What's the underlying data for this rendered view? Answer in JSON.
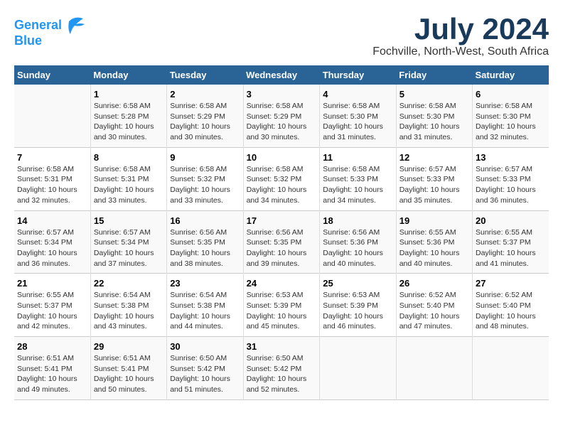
{
  "logo": {
    "line1": "General",
    "line2": "Blue"
  },
  "title": "July 2024",
  "location": "Fochville, North-West, South Africa",
  "days_header": [
    "Sunday",
    "Monday",
    "Tuesday",
    "Wednesday",
    "Thursday",
    "Friday",
    "Saturday"
  ],
  "rows": [
    [
      {
        "day": "",
        "content": ""
      },
      {
        "day": "1",
        "content": "Sunrise: 6:58 AM\nSunset: 5:28 PM\nDaylight: 10 hours\nand 30 minutes."
      },
      {
        "day": "2",
        "content": "Sunrise: 6:58 AM\nSunset: 5:29 PM\nDaylight: 10 hours\nand 30 minutes."
      },
      {
        "day": "3",
        "content": "Sunrise: 6:58 AM\nSunset: 5:29 PM\nDaylight: 10 hours\nand 30 minutes."
      },
      {
        "day": "4",
        "content": "Sunrise: 6:58 AM\nSunset: 5:30 PM\nDaylight: 10 hours\nand 31 minutes."
      },
      {
        "day": "5",
        "content": "Sunrise: 6:58 AM\nSunset: 5:30 PM\nDaylight: 10 hours\nand 31 minutes."
      },
      {
        "day": "6",
        "content": "Sunrise: 6:58 AM\nSunset: 5:30 PM\nDaylight: 10 hours\nand 32 minutes."
      }
    ],
    [
      {
        "day": "7",
        "content": "Sunrise: 6:58 AM\nSunset: 5:31 PM\nDaylight: 10 hours\nand 32 minutes."
      },
      {
        "day": "8",
        "content": "Sunrise: 6:58 AM\nSunset: 5:31 PM\nDaylight: 10 hours\nand 33 minutes."
      },
      {
        "day": "9",
        "content": "Sunrise: 6:58 AM\nSunset: 5:32 PM\nDaylight: 10 hours\nand 33 minutes."
      },
      {
        "day": "10",
        "content": "Sunrise: 6:58 AM\nSunset: 5:32 PM\nDaylight: 10 hours\nand 34 minutes."
      },
      {
        "day": "11",
        "content": "Sunrise: 6:58 AM\nSunset: 5:33 PM\nDaylight: 10 hours\nand 34 minutes."
      },
      {
        "day": "12",
        "content": "Sunrise: 6:57 AM\nSunset: 5:33 PM\nDaylight: 10 hours\nand 35 minutes."
      },
      {
        "day": "13",
        "content": "Sunrise: 6:57 AM\nSunset: 5:33 PM\nDaylight: 10 hours\nand 36 minutes."
      }
    ],
    [
      {
        "day": "14",
        "content": "Sunrise: 6:57 AM\nSunset: 5:34 PM\nDaylight: 10 hours\nand 36 minutes."
      },
      {
        "day": "15",
        "content": "Sunrise: 6:57 AM\nSunset: 5:34 PM\nDaylight: 10 hours\nand 37 minutes."
      },
      {
        "day": "16",
        "content": "Sunrise: 6:56 AM\nSunset: 5:35 PM\nDaylight: 10 hours\nand 38 minutes."
      },
      {
        "day": "17",
        "content": "Sunrise: 6:56 AM\nSunset: 5:35 PM\nDaylight: 10 hours\nand 39 minutes."
      },
      {
        "day": "18",
        "content": "Sunrise: 6:56 AM\nSunset: 5:36 PM\nDaylight: 10 hours\nand 40 minutes."
      },
      {
        "day": "19",
        "content": "Sunrise: 6:55 AM\nSunset: 5:36 PM\nDaylight: 10 hours\nand 40 minutes."
      },
      {
        "day": "20",
        "content": "Sunrise: 6:55 AM\nSunset: 5:37 PM\nDaylight: 10 hours\nand 41 minutes."
      }
    ],
    [
      {
        "day": "21",
        "content": "Sunrise: 6:55 AM\nSunset: 5:37 PM\nDaylight: 10 hours\nand 42 minutes."
      },
      {
        "day": "22",
        "content": "Sunrise: 6:54 AM\nSunset: 5:38 PM\nDaylight: 10 hours\nand 43 minutes."
      },
      {
        "day": "23",
        "content": "Sunrise: 6:54 AM\nSunset: 5:38 PM\nDaylight: 10 hours\nand 44 minutes."
      },
      {
        "day": "24",
        "content": "Sunrise: 6:53 AM\nSunset: 5:39 PM\nDaylight: 10 hours\nand 45 minutes."
      },
      {
        "day": "25",
        "content": "Sunrise: 6:53 AM\nSunset: 5:39 PM\nDaylight: 10 hours\nand 46 minutes."
      },
      {
        "day": "26",
        "content": "Sunrise: 6:52 AM\nSunset: 5:40 PM\nDaylight: 10 hours\nand 47 minutes."
      },
      {
        "day": "27",
        "content": "Sunrise: 6:52 AM\nSunset: 5:40 PM\nDaylight: 10 hours\nand 48 minutes."
      }
    ],
    [
      {
        "day": "28",
        "content": "Sunrise: 6:51 AM\nSunset: 5:41 PM\nDaylight: 10 hours\nand 49 minutes."
      },
      {
        "day": "29",
        "content": "Sunrise: 6:51 AM\nSunset: 5:41 PM\nDaylight: 10 hours\nand 50 minutes."
      },
      {
        "day": "30",
        "content": "Sunrise: 6:50 AM\nSunset: 5:42 PM\nDaylight: 10 hours\nand 51 minutes."
      },
      {
        "day": "31",
        "content": "Sunrise: 6:50 AM\nSunset: 5:42 PM\nDaylight: 10 hours\nand 52 minutes."
      },
      {
        "day": "",
        "content": ""
      },
      {
        "day": "",
        "content": ""
      },
      {
        "day": "",
        "content": ""
      }
    ]
  ]
}
